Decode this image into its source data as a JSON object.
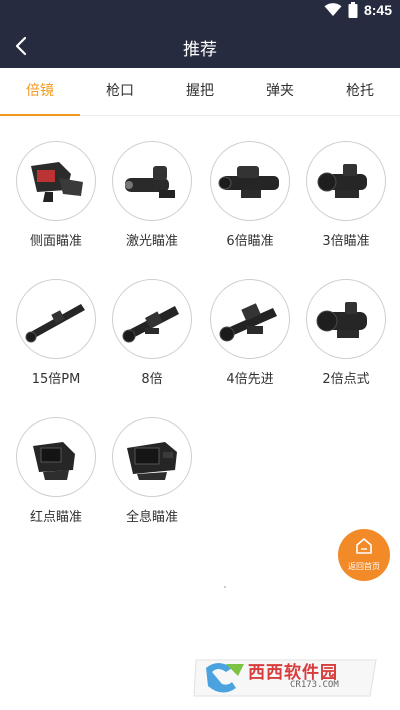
{
  "status_bar": {
    "time": "8:45",
    "icons": [
      "wifi-icon",
      "battery-icon"
    ]
  },
  "nav": {
    "title": "推荐",
    "back_icon": "chevron-left-icon"
  },
  "tabs": [
    {
      "label": "倍镜",
      "active": true
    },
    {
      "label": "枪口",
      "active": false
    },
    {
      "label": "握把",
      "active": false
    },
    {
      "label": "弹夹",
      "active": false
    },
    {
      "label": "枪托",
      "active": false
    }
  ],
  "items": [
    {
      "label": "侧面瞄准",
      "icon": "side-scope-icon"
    },
    {
      "label": "激光瞄准",
      "icon": "laser-sight-icon"
    },
    {
      "label": "6倍瞄准",
      "icon": "6x-scope-icon"
    },
    {
      "label": "3倍瞄准",
      "icon": "3x-scope-icon"
    },
    {
      "label": "15倍PM",
      "icon": "15x-scope-icon"
    },
    {
      "label": "8倍",
      "icon": "8x-scope-icon"
    },
    {
      "label": "4倍先进",
      "icon": "4x-scope-icon"
    },
    {
      "label": "2倍点式",
      "icon": "2x-scope-icon"
    },
    {
      "label": "红点瞄准",
      "icon": "red-dot-sight-icon"
    },
    {
      "label": "全息瞄准",
      "icon": "holographic-sight-icon"
    }
  ],
  "home_button": {
    "label": "返回首页",
    "icon": "home-icon"
  },
  "watermark": {
    "text": "西西软件园",
    "sub": "CR173.COM"
  },
  "colors": {
    "header_bg": "#262b3f",
    "accent": "#f39a1e",
    "home_btn": "#f38a28"
  }
}
